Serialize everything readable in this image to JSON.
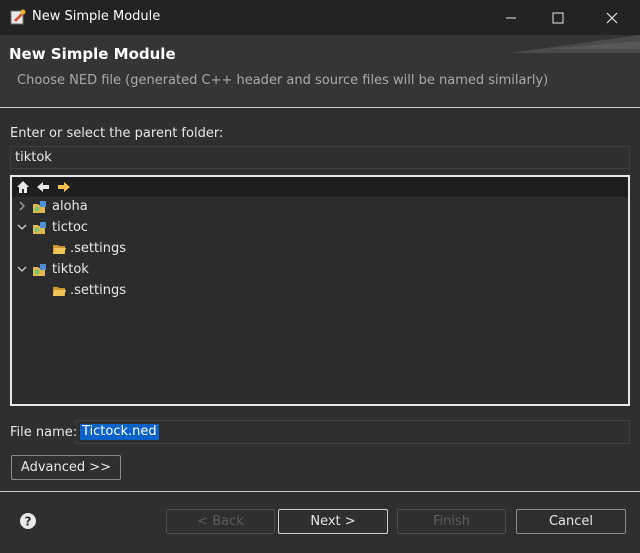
{
  "window": {
    "title": "New Simple Module",
    "controls": {
      "minimize": "minimize-icon",
      "maximize": "maximize-icon",
      "close": "close-icon"
    }
  },
  "banner": {
    "title": "New Simple Module",
    "description": "Choose NED file (generated C++ header and source files will be named similarly)"
  },
  "folder": {
    "label": "Enter or select the parent folder:",
    "value": "tiktok"
  },
  "tree": {
    "toolbar": [
      "home-icon",
      "back-arrow-icon",
      "forward-arrow-icon"
    ],
    "items": [
      {
        "label": "aloha",
        "expanded": false,
        "level": 0,
        "icon": "project-icon"
      },
      {
        "label": "tictoc",
        "expanded": true,
        "level": 0,
        "icon": "project-icon"
      },
      {
        "label": ".settings",
        "level": 1,
        "icon": "folder-icon"
      },
      {
        "label": "tiktok",
        "expanded": true,
        "level": 0,
        "icon": "project-icon"
      },
      {
        "label": ".settings",
        "level": 1,
        "icon": "folder-icon"
      }
    ]
  },
  "file": {
    "label": "File name:",
    "value": "Tictock.ned"
  },
  "buttons": {
    "advanced": "Advanced >>",
    "back": "< Back",
    "next": "Next >",
    "finish": "Finish",
    "cancel": "Cancel"
  },
  "colors": {
    "background": "#2f2f2f",
    "titlebar": "#232323",
    "selection": "#0a62c9"
  }
}
